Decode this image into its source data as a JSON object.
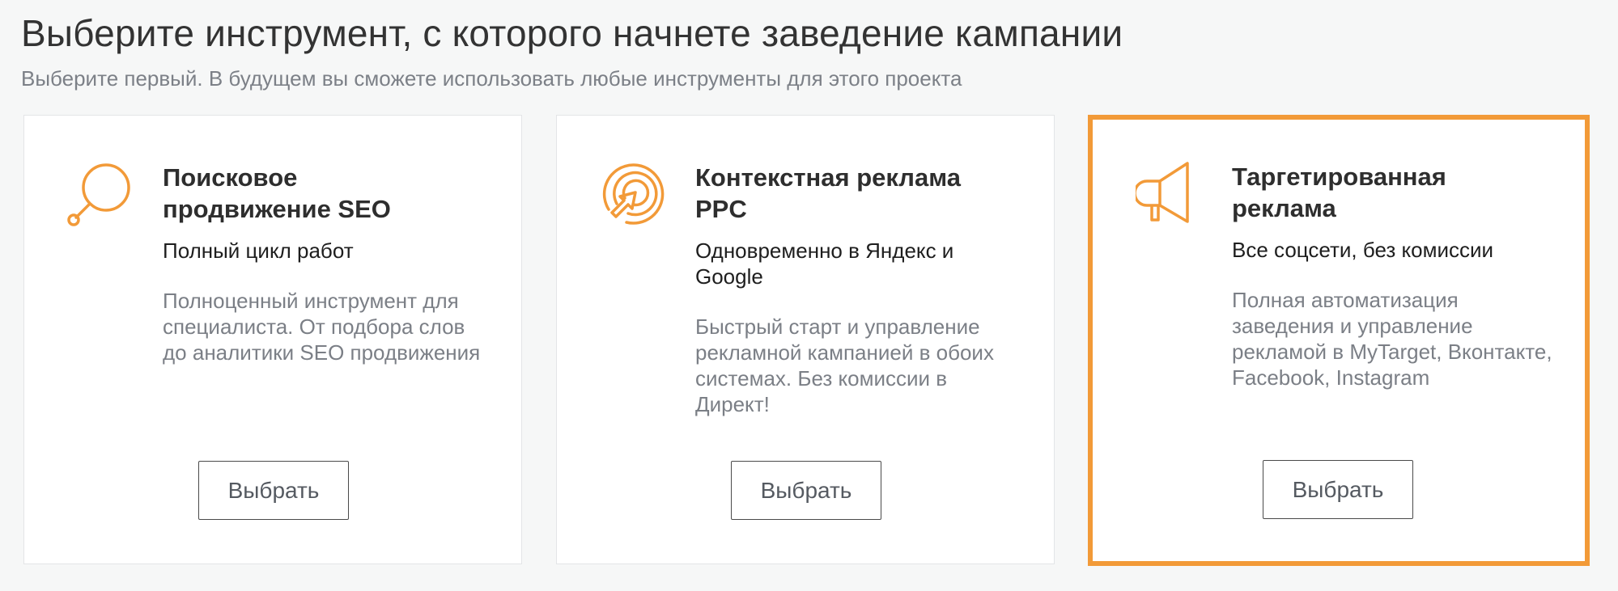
{
  "header": {
    "title": "Выберите инструмент, с которого начнете заведение кампании",
    "subtitle": "Выберите первый. В будущем вы сможете использовать любые инструменты для этого проекта"
  },
  "accent_color": "#f29a38",
  "cards": [
    {
      "icon": "search-icon",
      "title_line1": "Поисковое",
      "title_line2": "продвижение SEO",
      "tagline": "Полный цикл работ",
      "description": "Полноценный инструмент для специалиста. От подбора слов до аналитики SEO продвижения",
      "button_label": "Выбрать",
      "selected": false
    },
    {
      "icon": "target-cursor-icon",
      "title_line1": "Контекстная реклама",
      "title_line2": "PPC",
      "tagline": "Одновременно в Яндекс и Google",
      "description": "Быстрый старт и управление рекламной кампанией в обоих системах. Без комиссии в Директ!",
      "button_label": "Выбрать",
      "selected": false
    },
    {
      "icon": "megaphone-icon",
      "title_line1": "Таргетированная",
      "title_line2": "реклама",
      "tagline": "Все соцсети, без комиссии",
      "description": "Полная автоматизация заведения и управление рекламой в MyTarget, Вконтакте, Facebook, Instagram",
      "button_label": "Выбрать",
      "selected": true
    }
  ]
}
